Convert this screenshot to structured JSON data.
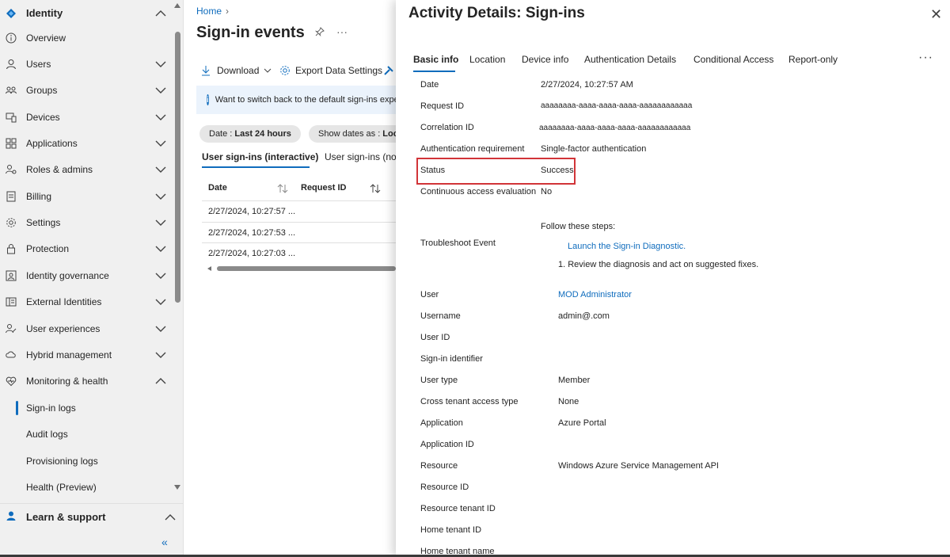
{
  "sidebar": {
    "header": "Identity",
    "items": [
      {
        "label": "Overview",
        "icon": "info-circle-icon"
      },
      {
        "label": "Users",
        "icon": "user-icon"
      },
      {
        "label": "Groups",
        "icon": "groups-icon"
      },
      {
        "label": "Devices",
        "icon": "devices-icon"
      },
      {
        "label": "Applications",
        "icon": "apps-grid-icon"
      },
      {
        "label": "Roles & admins",
        "icon": "roles-icon"
      },
      {
        "label": "Billing",
        "icon": "billing-doc-icon"
      },
      {
        "label": "Settings",
        "icon": "gear-icon"
      },
      {
        "label": "Protection",
        "icon": "lock-icon"
      },
      {
        "label": "Identity governance",
        "icon": "governance-icon"
      },
      {
        "label": "External Identities",
        "icon": "external-identities-icon"
      },
      {
        "label": "User experiences",
        "icon": "user-experience-icon"
      },
      {
        "label": "Hybrid management",
        "icon": "cloud-hybrid-icon"
      },
      {
        "label": "Monitoring & health",
        "icon": "heart-pulse-icon"
      }
    ],
    "sub_items": [
      "Sign-in logs",
      "Audit logs",
      "Provisioning logs",
      "Health (Preview)"
    ],
    "learn": "Learn & support"
  },
  "main": {
    "breadcrumb": "Home",
    "title": "Sign-in events",
    "toolbar": {
      "download": "Download",
      "export": "Export Data Settings"
    },
    "info": "Want to switch back to the default sign-ins experi",
    "pill_date_label": "Date : ",
    "pill_date_value": "Last 24 hours",
    "pill_show_label": "Show dates as : ",
    "pill_show_value": "Loca",
    "tabs": [
      "User sign-ins (interactive)",
      "User sign-ins (non"
    ],
    "columns": [
      "Date",
      "Request ID"
    ],
    "rows": [
      "2/27/2024, 10:27:57 ...",
      "2/27/2024, 10:27:53 ...",
      "2/27/2024, 10:27:03 ..."
    ]
  },
  "panel": {
    "title": "Activity Details: Sign-ins",
    "tabs": [
      "Basic info",
      "Location",
      "Device info",
      "Authentication Details",
      "Conditional Access",
      "Report-only"
    ],
    "fields": {
      "date_k": "Date",
      "date_v": "2/27/2024, 10:27:57 AM",
      "req_k": "Request ID",
      "req_v": "aaaaaaaa-aaaa-aaaa-aaaa-aaaaaaaaaaaa",
      "corr_k": "Correlation ID",
      "corr_v": "aaaaaaaa-aaaa-aaaa-aaaa-aaaaaaaaaaaa",
      "auth_k": "Authentication requirement",
      "auth_v": "Single-factor authentication",
      "status_k": "Status",
      "status_v": "Success",
      "cae_k": "Continuous access evaluation",
      "cae_v": "No",
      "trouble_k": "Troubleshoot Event",
      "follow": "Follow these steps:",
      "launch": "Launch the Sign-in Diagnostic.",
      "review": "1. Review the diagnosis and act on suggested fixes.",
      "user_k": "User",
      "user_v": "MOD Administrator",
      "username_k": "Username",
      "username_v": "admin@.com",
      "userid_k": "User ID",
      "signin_id_k": "Sign-in identifier",
      "usertype_k": "User type",
      "usertype_v": "Member",
      "cross_k": "Cross tenant access type",
      "cross_v": "None",
      "app_k": "Application",
      "app_v": "Azure Portal",
      "appid_k": "Application ID",
      "res_k": "Resource",
      "res_v": "Windows Azure Service Management API",
      "resid_k": "Resource ID",
      "restenant_k": "Resource tenant ID",
      "hometenant_k": "Home tenant ID",
      "hometenantname_k": "Home tenant name"
    }
  },
  "colors": {
    "accent": "#0f6cbd",
    "highlight": "#d13438",
    "sidebar_bg": "#f0f0f0"
  }
}
